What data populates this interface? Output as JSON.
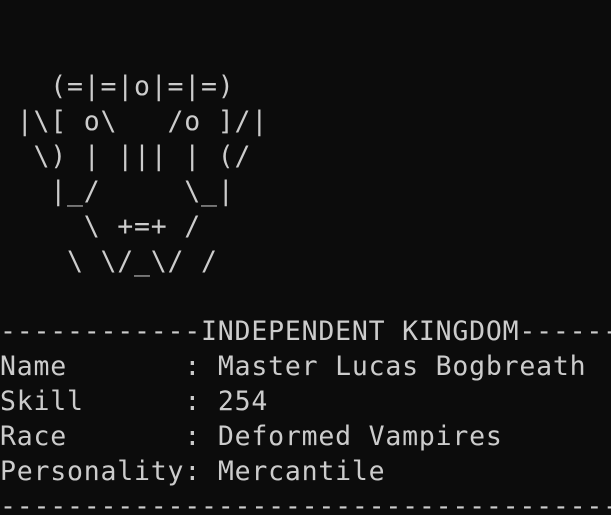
{
  "ascii_art": [
    "   (=|=|o|=|=)",
    " |\\[ o\\   /o ]/|",
    "  \\) | ||| | (/",
    "   |_/     \\_|",
    "     \\ +=+ /",
    "    \\ \\/_\\/ /"
  ],
  "header_separator": "------------INDEPENDENT KINGDOM------------",
  "fields": [
    {
      "label": "Name       ",
      "separator": ": ",
      "value": "Master Lucas Bogbreath"
    },
    {
      "label": "Skill      ",
      "separator": ": ",
      "value": "254"
    },
    {
      "label": "Race       ",
      "separator": ": ",
      "value": "Deformed Vampires"
    },
    {
      "label": "Personality",
      "separator": ": ",
      "value": "Mercantile"
    }
  ],
  "footer_separator": "--------------------------------------------",
  "colors": {
    "background": "#0c0c0c",
    "text": "#cccccc"
  }
}
